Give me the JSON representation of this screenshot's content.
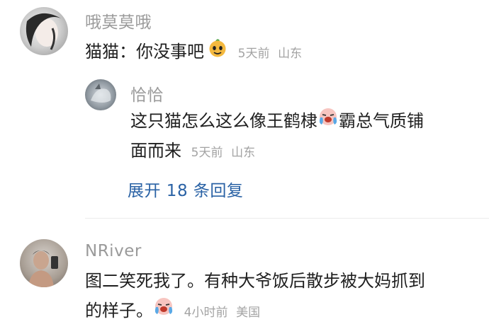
{
  "comments": [
    {
      "username": "哦莫莫哦",
      "text": "猫猫：你没事吧",
      "emoji_icon": "smiling-face-emoji",
      "time": "5天前",
      "location": "山东"
    },
    {
      "username": "NRiver",
      "text_line1": "图二笑死我了。有种大爷饭后散步被大妈抓到",
      "text_line2": "的样子。",
      "emoji_icon": "crying-laughing-emoji",
      "time": "4小时前",
      "location": "美国"
    }
  ],
  "reply": {
    "username": "恰恰",
    "text_line1_a": "这只猫怎么这么像王鹤棣",
    "emoji_icon": "crying-laughing-emoji",
    "text_line1_b": "霸总气质铺",
    "text_line2": "面而来",
    "time": "5天前",
    "location": "山东"
  },
  "expand_replies_label": "展开 18 条回复",
  "colors": {
    "username": "#9a9a9a",
    "text": "#1f1f1f",
    "meta": "#a3a3a3",
    "link": "#2a62a5"
  }
}
